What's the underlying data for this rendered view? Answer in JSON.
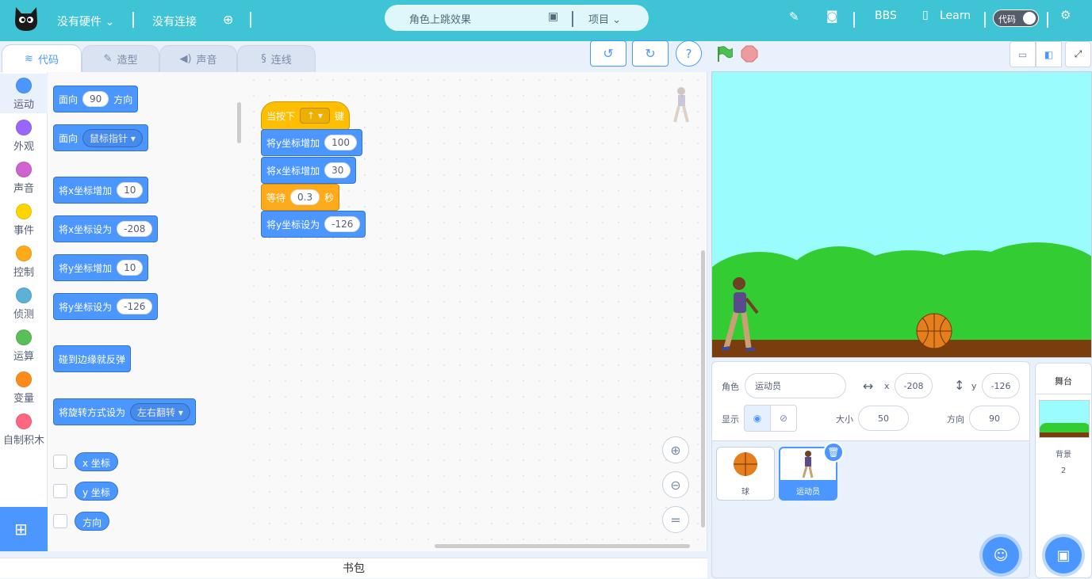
{
  "topbar": {
    "hardware": "没有硬件",
    "connection": "没有连接",
    "project_title": "角色上跳效果",
    "project_menu": "项目",
    "bbs": "BBS",
    "learn": "Learn",
    "code_toggle": "代码"
  },
  "tabs": {
    "code": "代码",
    "costume": "造型",
    "sound": "声音",
    "wire": "连线"
  },
  "categories": [
    "运动",
    "外观",
    "声音",
    "事件",
    "控制",
    "侦测",
    "运算",
    "变量",
    "自制积木"
  ],
  "category_colors": [
    "#4c97ff",
    "#9966ff",
    "#cf63cf",
    "#ffd500",
    "#ffab19",
    "#5cb1d6",
    "#59c059",
    "#ff8c1a",
    "#ff6680"
  ],
  "palette": {
    "point_dir_label": "面向",
    "point_dir_value": "90",
    "point_dir_suffix": "方向",
    "point_to_label": "面向",
    "point_to_value": "鼠标指针",
    "change_x_label": "将x坐标增加",
    "change_x_value": "10",
    "set_x_label": "将x坐标设为",
    "set_x_value": "-208",
    "change_y_label": "将y坐标增加",
    "change_y_value": "10",
    "set_y_label": "将y坐标设为",
    "set_y_value": "-126",
    "bounce_label": "碰到边缘就反弹",
    "rotation_label": "将旋转方式设为",
    "rotation_value": "左右翻转",
    "rep_x": "x 坐标",
    "rep_y": "y 坐标",
    "rep_dir": "方向"
  },
  "script": {
    "hat_prefix": "当按下",
    "hat_key": "↑",
    "hat_suffix": "键",
    "b1_label": "将y坐标增加",
    "b1_value": "100",
    "b2_label": "将x坐标增加",
    "b2_value": "30",
    "b3_label": "等待",
    "b3_value": "0.3",
    "b3_suffix": "秒",
    "b4_label": "将y坐标设为",
    "b4_value": "-126"
  },
  "backpack": "书包",
  "sprite_info": {
    "sprite_label": "角色",
    "sprite_name": "运动员",
    "x_label": "x",
    "x_value": "-208",
    "y_label": "y",
    "y_value": "-126",
    "show_label": "显示",
    "size_label": "大小",
    "size_value": "50",
    "dir_label": "方向",
    "dir_value": "90"
  },
  "sprites": [
    {
      "name": "球"
    },
    {
      "name": "运动员"
    }
  ],
  "stage_panel": {
    "title": "舞台",
    "backdrop_label": "背景",
    "backdrop_count": "2"
  }
}
